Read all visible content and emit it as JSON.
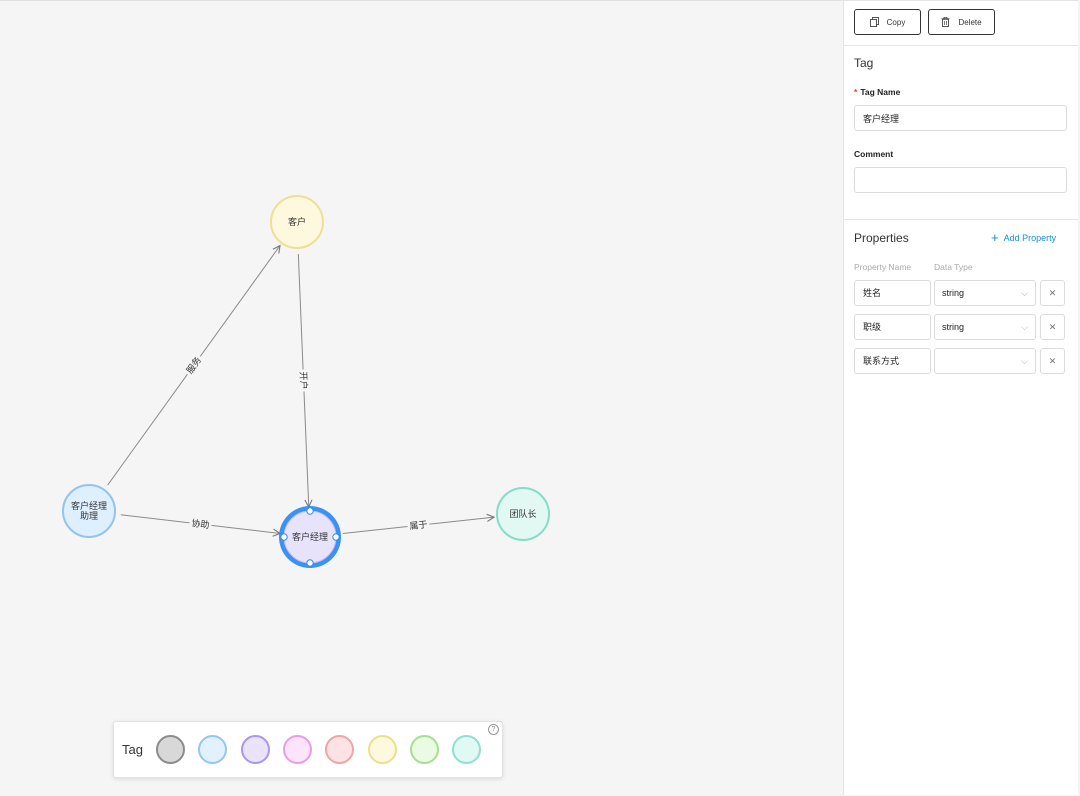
{
  "graph": {
    "nodes": [
      {
        "id": "customer",
        "label": "客户",
        "fill": "#fdf8de",
        "stroke": "#ede096"
      },
      {
        "id": "assistant",
        "label": "客户经理助理",
        "lines": [
          "客户经理",
          "助理"
        ],
        "fill": "#deefff",
        "stroke": "#92c4ec"
      },
      {
        "id": "manager",
        "label": "客户经理",
        "fill": "#e6e3fb",
        "stroke": "#2f8cf3",
        "selected": true
      },
      {
        "id": "team_lead",
        "label": "团队长",
        "fill": "#e2f8f2",
        "stroke": "#84ddc8"
      }
    ],
    "edges": [
      {
        "from": "assistant",
        "to": "customer",
        "label": "服务"
      },
      {
        "from": "customer",
        "to": "manager",
        "label": "开户"
      },
      {
        "from": "assistant",
        "to": "manager",
        "label": "协助"
      },
      {
        "from": "manager",
        "to": "team_lead",
        "label": "属于"
      }
    ]
  },
  "palette": {
    "label": "Tag",
    "help_icon": "question-circle-icon",
    "swatches": [
      {
        "fill": "#d8d8d8",
        "stroke": "#8c8c8c"
      },
      {
        "fill": "#e2f1ff",
        "stroke": "#93c7ef"
      },
      {
        "fill": "#e9e3fc",
        "stroke": "#a897ec"
      },
      {
        "fill": "#fde4fb",
        "stroke": "#ec9ce2"
      },
      {
        "fill": "#fde3e3",
        "stroke": "#efa5a5"
      },
      {
        "fill": "#fdf9de",
        "stroke": "#ecdf8a"
      },
      {
        "fill": "#e9fbe2",
        "stroke": "#a6e08e"
      },
      {
        "fill": "#e1f9f4",
        "stroke": "#8fe0d0"
      }
    ]
  },
  "panel": {
    "copy_label": "Copy",
    "delete_label": "Delete",
    "copy_icon": "copy-icon",
    "delete_icon": "trash-icon",
    "tag_section_title": "Tag",
    "tag_name_label": "Tag Name",
    "tag_name_value": "客户经理",
    "comment_label": "Comment",
    "comment_value": "",
    "properties_title": "Properties",
    "add_property_label": "Add Property",
    "col_property_name": "Property Name",
    "col_data_type": "Data Type",
    "properties": [
      {
        "name": "姓名",
        "type": "string"
      },
      {
        "name": "职级",
        "type": "string"
      },
      {
        "name": "联系方式",
        "type": ""
      }
    ],
    "accent_color": "#1a8cd8"
  }
}
